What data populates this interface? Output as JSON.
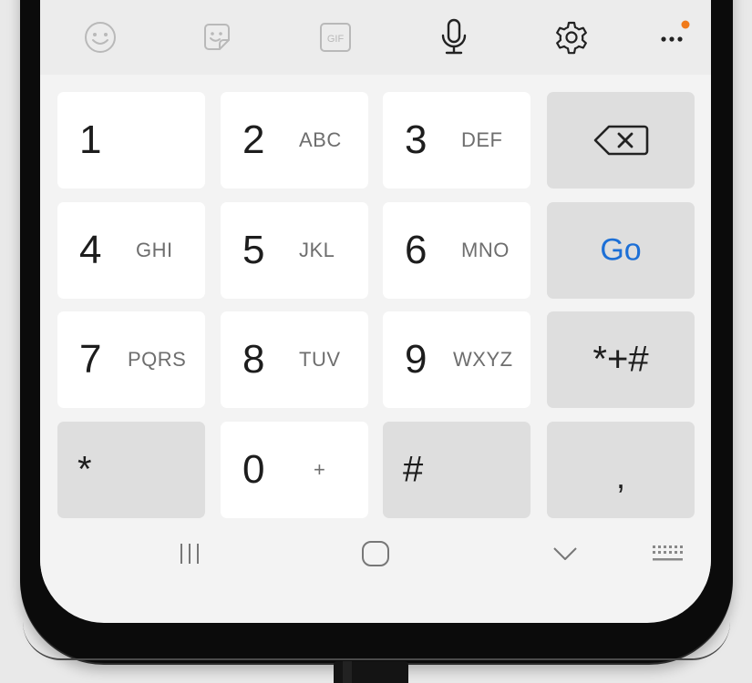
{
  "toolbar": {
    "icons": [
      "emoji-icon",
      "sticker-icon",
      "gif-icon",
      "microphone-icon",
      "settings-icon",
      "more-options-icon"
    ],
    "gif_label": "GIF",
    "notification_dot_color": "#f07a1a"
  },
  "keys": {
    "k1": {
      "digit": "1",
      "letters": ""
    },
    "k2": {
      "digit": "2",
      "letters": "ABC"
    },
    "k3": {
      "digit": "3",
      "letters": "DEF"
    },
    "k4": {
      "digit": "4",
      "letters": "GHI"
    },
    "k5": {
      "digit": "5",
      "letters": "JKL"
    },
    "k6": {
      "digit": "6",
      "letters": "MNO"
    },
    "k7": {
      "digit": "7",
      "letters": "PQRS"
    },
    "k8": {
      "digit": "8",
      "letters": "TUV"
    },
    "k9": {
      "digit": "9",
      "letters": "WXYZ"
    },
    "k0": {
      "digit": "0",
      "letters": "+"
    },
    "go": "Go",
    "symbols": "*+#",
    "star": "*",
    "hash": "#",
    "comma": ","
  },
  "colors": {
    "accent": "#1c6fd6",
    "key_bg": "#ffffff",
    "function_key_bg": "#dedede",
    "keyboard_bg": "#f3f3f3"
  },
  "navbar": {
    "icons": [
      "recents-icon",
      "home-icon",
      "hide-keyboard-icon",
      "keyboard-switch-icon"
    ]
  }
}
